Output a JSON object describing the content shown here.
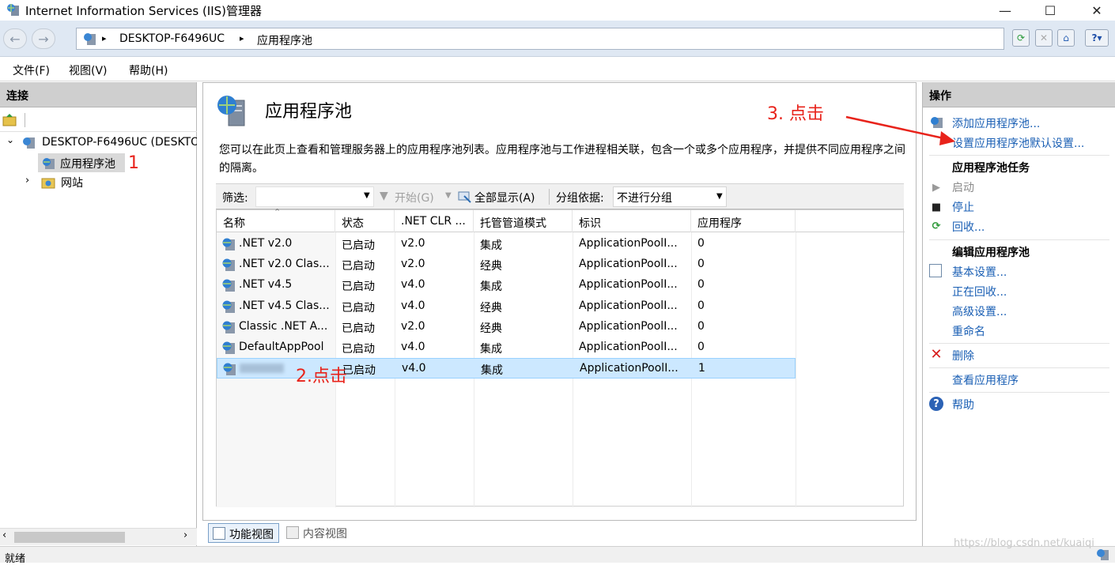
{
  "window": {
    "title": "Internet Information Services (IIS)管理器",
    "minimize": "—",
    "maximize": "☐",
    "close": "✕"
  },
  "address": {
    "segments": [
      "DESKTOP-F6496UC",
      "应用程序池"
    ],
    "sep": "▸"
  },
  "menu": [
    "文件(F)",
    "视图(V)",
    "帮助(H)"
  ],
  "connections": {
    "header": "连接",
    "tree": [
      {
        "label": "DESKTOP-F6496UC (DESKTOP-F6496UC\\",
        "expander": "⌄"
      },
      {
        "label": "应用程序池",
        "selected": true
      },
      {
        "label": "网站",
        "expander": "›"
      }
    ]
  },
  "page": {
    "title": "应用程序池",
    "description": "您可以在此页上查看和管理服务器上的应用程序池列表。应用程序池与工作进程相关联，包含一个或多个应用程序，并提供不同应用程序之间的隔离。",
    "filter": {
      "label": "筛选:",
      "start": "开始(G)",
      "show_all": "全部显示(A)",
      "group_label": "分组依据:",
      "group_value": "不进行分组"
    },
    "columns": [
      "名称",
      "状态",
      ".NET CLR ...",
      "托管管道模式",
      "标识",
      "应用程序"
    ],
    "rows": [
      [
        ".NET v2.0",
        "已启动",
        "v2.0",
        "集成",
        "ApplicationPoolI...",
        "0"
      ],
      [
        ".NET v2.0 Clas...",
        "已启动",
        "v2.0",
        "经典",
        "ApplicationPoolI...",
        "0"
      ],
      [
        ".NET v4.5",
        "已启动",
        "v4.0",
        "集成",
        "ApplicationPoolI...",
        "0"
      ],
      [
        ".NET v4.5 Clas...",
        "已启动",
        "v4.0",
        "经典",
        "ApplicationPoolI...",
        "0"
      ],
      [
        "Classic .NET A...",
        "已启动",
        "v2.0",
        "经典",
        "ApplicationPoolI...",
        "0"
      ],
      [
        "DefaultAppPool",
        "已启动",
        "v4.0",
        "集成",
        "ApplicationPoolI...",
        "0"
      ],
      [
        "",
        "已启动",
        "v4.0",
        "集成",
        "ApplicationPoolI...",
        "1"
      ]
    ],
    "selected_row": 6
  },
  "viewtabs": [
    "功能视图",
    "内容视图"
  ],
  "actions": {
    "header": "操作",
    "top": [
      "添加应用程序池...",
      "设置应用程序池默认设置..."
    ],
    "group1": {
      "title": "应用程序池任务",
      "items": [
        "启动",
        "停止",
        "回收..."
      ]
    },
    "group2": {
      "title": "编辑应用程序池",
      "items": [
        "基本设置...",
        "正在回收...",
        "高级设置...",
        "重命名"
      ]
    },
    "delete": "删除",
    "view_apps": "查看应用程序",
    "help": "帮助"
  },
  "status": {
    "text": "就绪",
    "watermark": "https://blog.csdn.net/kuaiqi"
  },
  "annotations": {
    "a1": "1",
    "a2": "2.点击",
    "a3": "3. 点击"
  },
  "colors": {
    "accent_red": "#e8231b",
    "link_blue": "#1a5fb4",
    "selection": "#cce8ff"
  }
}
